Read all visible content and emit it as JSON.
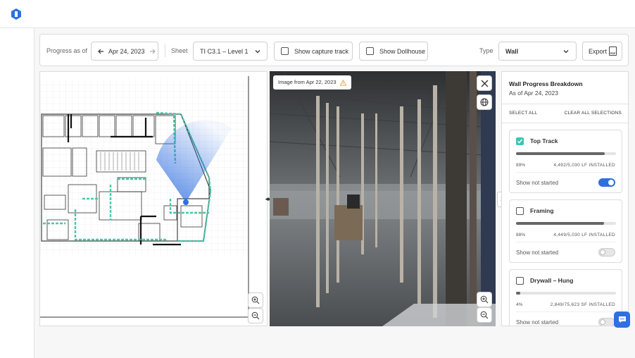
{
  "toolbar": {
    "progress_label": "Progress as of",
    "date": "Apr 24, 2023",
    "sheet_label": "Sheet",
    "sheet_value": "TI C3.1 – Level 1",
    "show_capture_track": "Show capture track",
    "show_dollhouse": "Show Dollhouse",
    "type_label": "Type",
    "type_value": "Wall",
    "export_label": "Export",
    "pdf_label": "PDF"
  },
  "photo": {
    "image_date": "Image from Apr 22, 2023"
  },
  "panel": {
    "title": "Wall Progress Breakdown",
    "subtitle": "As of Apr 24, 2023",
    "select_all": "SELECT ALL",
    "clear_all": "CLEAR ALL SELECTIONS",
    "show_not_started": "Show not started",
    "items": [
      {
        "name": "Top Track",
        "percent": "89%",
        "progress": 0.89,
        "quantity": "4,492/5,030 LF INSTALLED",
        "checked": true,
        "show_not_started": true
      },
      {
        "name": "Framing",
        "percent": "88%",
        "progress": 0.88,
        "quantity": "4,449/5,030 LF INSTALLED",
        "checked": false,
        "show_not_started": false
      },
      {
        "name": "Drywall – Hung",
        "percent": "4%",
        "progress": 0.04,
        "quantity": "2,849/75,623 SF INSTALLED",
        "checked": false,
        "show_not_started": false
      }
    ]
  },
  "colors": {
    "accent_blue": "#2f6fe0",
    "check_teal": "#3fc4b4",
    "plan_green": "#47c9a9",
    "warning": "#e7a33a"
  },
  "icons": [
    "logo-icon",
    "arrow-left-icon",
    "arrow-right-icon",
    "chevron-down-icon",
    "checkbox-icon",
    "pdf-icon",
    "close-icon",
    "globe-icon",
    "warning-icon",
    "zoom-in-icon",
    "zoom-out-icon",
    "chevron-right-icon",
    "chat-icon",
    "split-handle-icon"
  ]
}
